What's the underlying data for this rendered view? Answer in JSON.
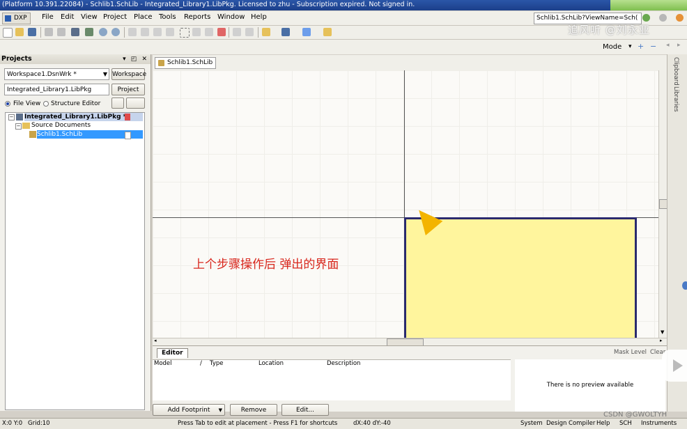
{
  "window": {
    "title": "(Platform 10.391.22084) - Schlib1.SchLib - Integrated_Library1.LibPkg. Licensed to zhu - Subscription expired. Not signed in."
  },
  "menubar": {
    "dxp": "DXP",
    "items": [
      "File",
      "Edit",
      "View",
      "Project",
      "Place",
      "Tools",
      "Reports",
      "Window",
      "Help"
    ],
    "path": "Schlib1.SchLib?ViewName=Sch("
  },
  "toolbar2": {
    "mode": "Mode"
  },
  "watermark": "追风听 @刘永亚",
  "projects": {
    "header": "Projects",
    "workspace_value": "Workspace1.DsnWrk *",
    "workspace_btn": "Workspace",
    "project_value": "Integrated_Library1.LibPkg",
    "project_btn": "Project",
    "radio_file": "File View",
    "radio_struct": "Structure Editor",
    "tree": [
      {
        "label": "Integrated_Library1.LibPkg *"
      },
      {
        "label": "Source Documents"
      },
      {
        "label": "Schlib1.SchLib"
      }
    ]
  },
  "doc_tab": "Schlib1.SchLib",
  "canvas": {
    "annotation": "上个步骤操作后 弹出的界面"
  },
  "right_panels": [
    "Clipboard",
    "Libraries"
  ],
  "editor": {
    "tab": "Editor",
    "mask_level": "Mask Level",
    "clear": "Clear",
    "columns": [
      "Model",
      "Type",
      "Location",
      "Description"
    ],
    "preview": "There is no preview available",
    "buttons": {
      "add_footprint": "Add Footprint",
      "remove": "Remove",
      "edit": "Edit..."
    }
  },
  "statusbar": {
    "xy": "X:0 Y:0",
    "grid": "Grid:10",
    "hint": "Press Tab to edit at placement - Press F1 for shortcuts",
    "dxy": "dX:40 dY:-40",
    "panels": [
      "System",
      "Design Compiler",
      "Help",
      "SCH",
      "Instruments"
    ]
  },
  "csdn_watermark": "CSDN @GWOLTYH",
  "colors": {
    "title_blue": "#1c3f8a",
    "part_body_fill": "#fff59d",
    "part_body_border": "#2a2a6e",
    "annotation_red": "#d8261c",
    "cursor_orange": "#f3b400",
    "selection_blue": "#3399ff"
  }
}
